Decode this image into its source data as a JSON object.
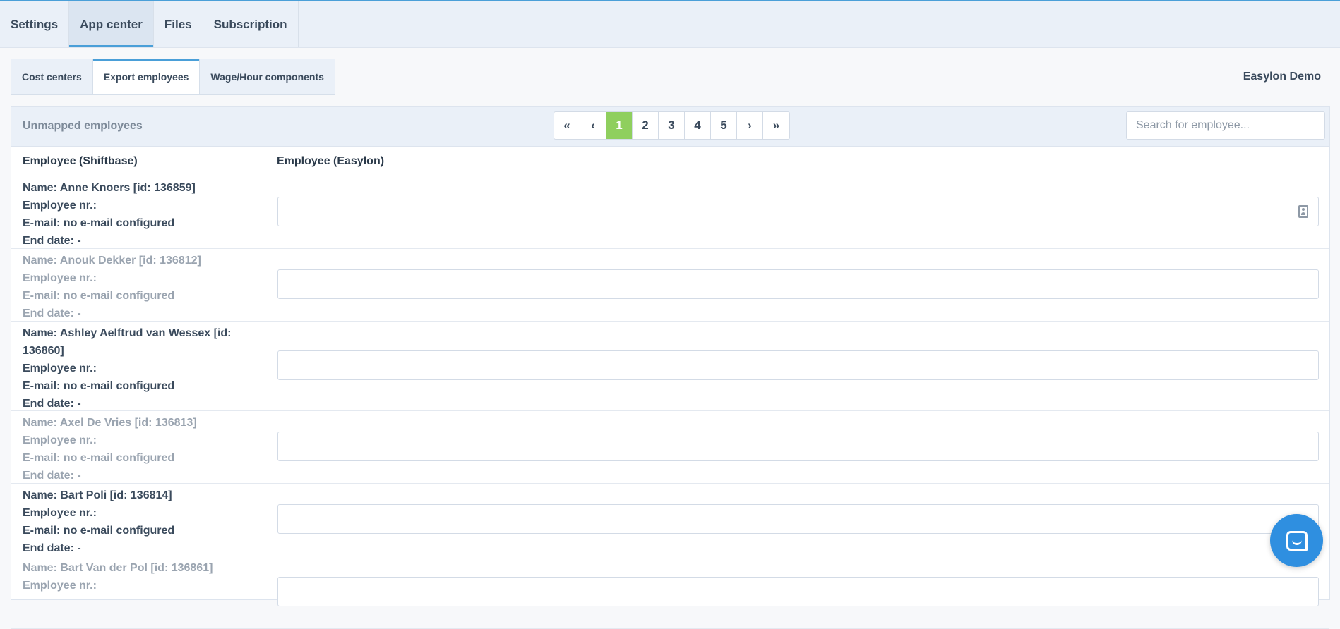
{
  "top_tabs": [
    {
      "label": "Settings"
    },
    {
      "label": "App center",
      "active": true
    },
    {
      "label": "Files"
    },
    {
      "label": "Subscription"
    }
  ],
  "sub_tabs": [
    {
      "label": "Cost centers"
    },
    {
      "label": "Export employees",
      "active": true
    },
    {
      "label": "Wage/Hour components"
    }
  ],
  "account_name": "Easylon Demo",
  "panel": {
    "title": "Unmapped employees",
    "search_placeholder": "Search for employee..."
  },
  "pagination": {
    "first": "«",
    "prev": "‹",
    "pages": [
      "1",
      "2",
      "3",
      "4",
      "5"
    ],
    "current": "1",
    "next": "›",
    "last": "»"
  },
  "columns": {
    "shiftbase": "Employee (Shiftbase)",
    "easylon": "Employee (Easylon)"
  },
  "rows": [
    {
      "name": "Name: Anne Knoers [id: 136859]",
      "nr": "Employee nr.:",
      "email": "E-mail: no e-mail configured",
      "end": "End date: -",
      "muted": false
    },
    {
      "name": "Name: Anouk Dekker [id: 136812]",
      "nr": "Employee nr.:",
      "email": "E-mail: no e-mail configured",
      "end": "End date: -",
      "muted": true
    },
    {
      "name": "Name: Ashley Aelftrud van Wessex [id: 136860]",
      "nr": "Employee nr.:",
      "email": "E-mail: no e-mail configured",
      "end": "End date: -",
      "muted": false
    },
    {
      "name": "Name: Axel De Vries [id: 136813]",
      "nr": "Employee nr.:",
      "email": "E-mail: no e-mail configured",
      "end": "End date: -",
      "muted": true
    },
    {
      "name": "Name: Bart Poli [id: 136814]",
      "nr": "Employee nr.:",
      "email": "E-mail: no e-mail configured",
      "end": "End date: -",
      "muted": false
    },
    {
      "name": "Name: Bart Van der Pol [id: 136861]",
      "nr": "Employee nr.:",
      "email": "",
      "end": "",
      "muted": true
    }
  ],
  "icons": {
    "field_icon": "contact-card-icon",
    "chat": "chat-bubble-icon"
  },
  "colors": {
    "accent": "#4a9fd8",
    "active_page": "#8fcf5e",
    "chat": "#2f8fe0"
  }
}
